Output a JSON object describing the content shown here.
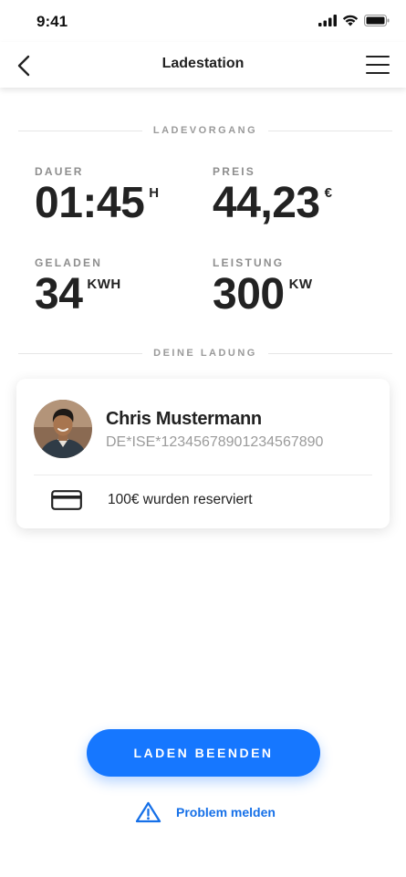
{
  "status_bar": {
    "time": "9:41"
  },
  "nav": {
    "title": "Ladestation"
  },
  "sections": {
    "session": "LADEVORGANG",
    "charge": "DEINE LADUNG"
  },
  "stats": {
    "duration": {
      "label": "DAUER",
      "value": "01:45",
      "unit": "H"
    },
    "price": {
      "label": "PREIS",
      "value": "44,23",
      "unit": "€"
    },
    "charged": {
      "label": "GELADEN",
      "value": "34",
      "unit": "KWH"
    },
    "power": {
      "label": "LEISTUNG",
      "value": "300",
      "unit": "KW"
    }
  },
  "card": {
    "name": "Chris Mustermann",
    "id": "DE*ISE*12345678901234567890",
    "reservation": "100€ wurden reserviert",
    "payment_icon": "credit-card-icon"
  },
  "actions": {
    "stop_label": "LADEN BEENDEN",
    "problem_label": "Problem melden",
    "problem_icon": "warning-icon"
  },
  "colors": {
    "accent": "#1677ff",
    "link": "#1670e8",
    "muted": "#9a9a9a"
  }
}
